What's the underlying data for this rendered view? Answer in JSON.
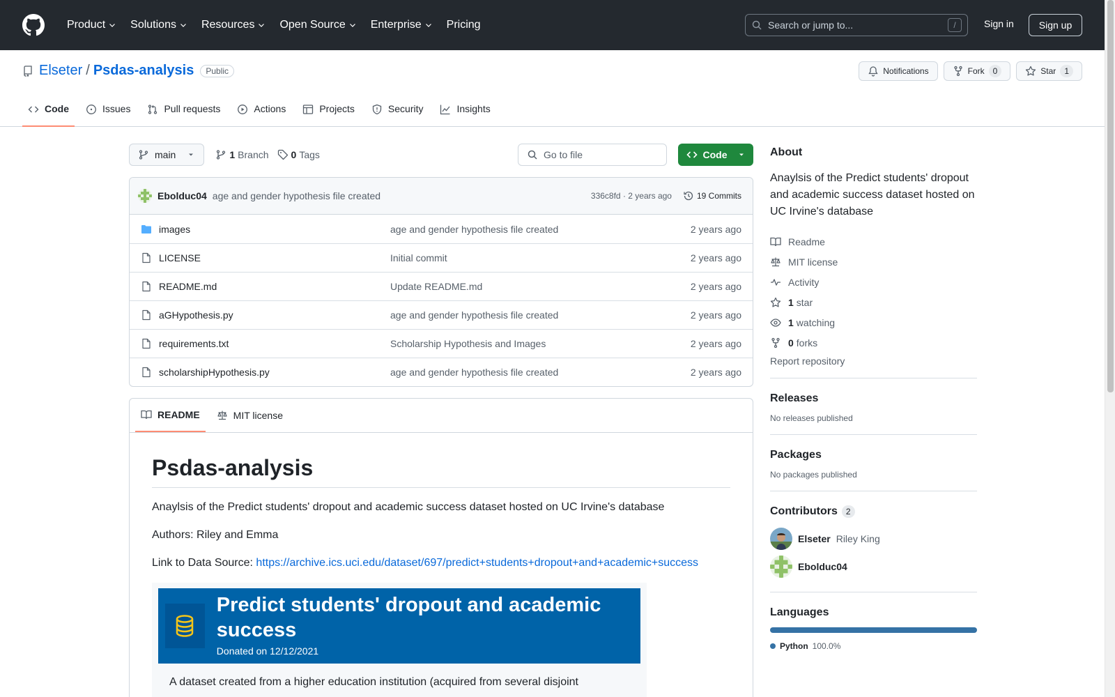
{
  "header": {
    "nav": [
      "Product",
      "Solutions",
      "Resources",
      "Open Source",
      "Enterprise",
      "Pricing"
    ],
    "search_placeholder": "Search or jump to...",
    "search_shortcut": "/",
    "sign_in": "Sign in",
    "sign_up": "Sign up"
  },
  "repo": {
    "owner": "Elseter",
    "separator": "/",
    "name": "Psdas-analysis",
    "visibility": "Public",
    "actions": {
      "notifications": "Notifications",
      "fork": "Fork",
      "fork_count": "0",
      "star": "Star",
      "star_count": "1"
    },
    "tabs": [
      "Code",
      "Issues",
      "Pull requests",
      "Actions",
      "Projects",
      "Security",
      "Insights"
    ]
  },
  "toolbar": {
    "branch": "main",
    "branch_count": "1",
    "branch_label": "Branch",
    "tag_count": "0",
    "tag_label": "Tags",
    "goto_placeholder": "Go to file",
    "code_label": "Code"
  },
  "commit": {
    "author": "Ebolduc04",
    "message": "age and gender hypothesis file created",
    "meta": "336c8fd · 2 years ago",
    "commits": "19 Commits"
  },
  "files": [
    {
      "name": "images",
      "type": "folder",
      "message": "age and gender hypothesis file created",
      "date": "2 years ago"
    },
    {
      "name": "LICENSE",
      "type": "file",
      "message": "Initial commit",
      "date": "2 years ago"
    },
    {
      "name": "README.md",
      "type": "file",
      "message": "Update README.md",
      "date": "2 years ago"
    },
    {
      "name": "aGHypothesis.py",
      "type": "file",
      "message": "age and gender hypothesis file created",
      "date": "2 years ago"
    },
    {
      "name": "requirements.txt",
      "type": "file",
      "message": "Scholarship Hypothesis and Images",
      "date": "2 years ago"
    },
    {
      "name": "scholarshipHypothesis.py",
      "type": "file",
      "message": "age and gender hypothesis file created",
      "date": "2 years ago"
    }
  ],
  "readme": {
    "tabs": [
      "README",
      "MIT license"
    ],
    "title": "Psdas-analysis",
    "description": "Anaylsis of the Predict students' dropout and academic success dataset hosted on UC Irvine's database",
    "authors": "Authors: Riley and Emma",
    "link_prefix": "Link to Data Source: ",
    "link": "https://archive.ics.uci.edu/dataset/697/predict+students+dropout+and+academic+success",
    "embed": {
      "title": "Predict students' dropout and academic success",
      "donated": "Donated on 12/12/2021",
      "desc": "A dataset created from a higher education institution (acquired from several disjoint"
    }
  },
  "sidebar": {
    "about_title": "About",
    "about_desc": "Anaylsis of the Predict students' dropout and academic success dataset hosted on UC Irvine's database",
    "links": {
      "readme": "Readme",
      "license": "MIT license",
      "activity": "Activity",
      "stars_count": "1",
      "stars_label": "star",
      "watching_count": "1",
      "watching_label": "watching",
      "forks_count": "0",
      "forks_label": "forks"
    },
    "report": "Report repository",
    "releases_title": "Releases",
    "releases_empty": "No releases published",
    "packages_title": "Packages",
    "packages_empty": "No packages published",
    "contributors_title": "Contributors",
    "contributors_count": "2",
    "contributors": [
      {
        "login": "Elseter",
        "name": "Riley King"
      },
      {
        "login": "Ebolduc04",
        "name": ""
      }
    ],
    "languages_title": "Languages",
    "languages": [
      {
        "name": "Python",
        "percent": "100.0%",
        "color": "#3572a5"
      }
    ]
  }
}
